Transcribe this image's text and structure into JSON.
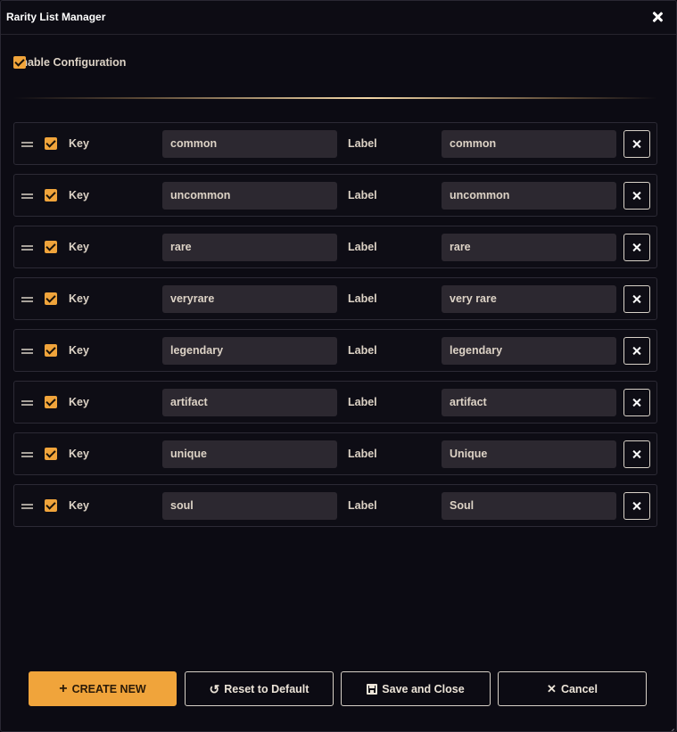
{
  "window": {
    "title": "Rarity List Manager",
    "close_icon": "close-icon"
  },
  "config": {
    "enable_label": "Enable Configuration",
    "enabled": true
  },
  "row_labels": {
    "key": "Key",
    "label": "Label"
  },
  "rows": [
    {
      "enabled": true,
      "key": "common",
      "label": "common"
    },
    {
      "enabled": true,
      "key": "uncommon",
      "label": "uncommon"
    },
    {
      "enabled": true,
      "key": "rare",
      "label": "rare"
    },
    {
      "enabled": true,
      "key": "veryrare",
      "label": "very rare"
    },
    {
      "enabled": true,
      "key": "legendary",
      "label": "legendary"
    },
    {
      "enabled": true,
      "key": "artifact",
      "label": "artifact"
    },
    {
      "enabled": true,
      "key": "unique",
      "label": "Unique"
    },
    {
      "enabled": true,
      "key": "soul",
      "label": "Soul"
    }
  ],
  "footer": {
    "create_label": "CREATE NEW",
    "reset_label": "Reset to Default",
    "save_label": "Save and Close",
    "cancel_label": "Cancel"
  },
  "colors": {
    "accent": "#f0a43b",
    "background": "#0c0b13",
    "field": "#2c2830",
    "text": "#ddd3c6"
  }
}
